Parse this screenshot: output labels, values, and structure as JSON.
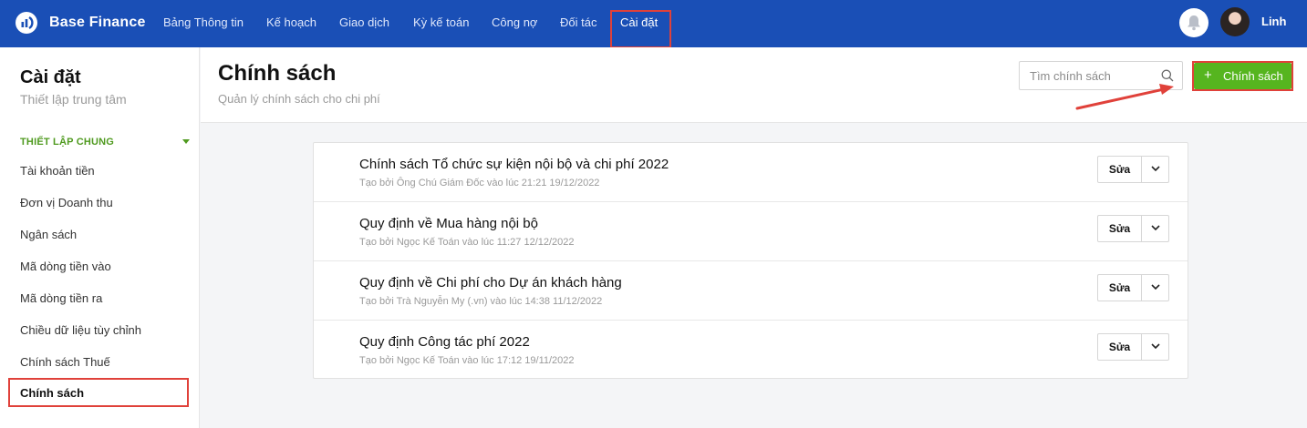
{
  "app": {
    "brand": "Base Finance",
    "user_name": "Linh"
  },
  "nav": {
    "items": [
      {
        "label": "Bảng Thông tin"
      },
      {
        "label": "Kế hoạch"
      },
      {
        "label": "Giao dịch"
      },
      {
        "label": "Kỳ kế toán"
      },
      {
        "label": "Công nợ"
      },
      {
        "label": "Đối tác"
      },
      {
        "label": "Cài đặt",
        "active": true
      }
    ]
  },
  "sidebar": {
    "title": "Cài đặt",
    "subtitle": "Thiết lập trung tâm",
    "section": "THIẾT LẬP CHUNG",
    "items": [
      {
        "label": "Tài khoản tiền"
      },
      {
        "label": "Đơn vị Doanh thu"
      },
      {
        "label": "Ngân sách"
      },
      {
        "label": "Mã dòng tiền vào"
      },
      {
        "label": "Mã dòng tiền ra"
      },
      {
        "label": "Chiều dữ liệu tùy chỉnh"
      },
      {
        "label": "Chính sách Thuế"
      },
      {
        "label": "Chính sách",
        "active": true
      }
    ]
  },
  "header": {
    "title": "Chính sách",
    "subtitle": "Quản lý chính sách cho chi phí",
    "search_placeholder": "Tìm chính sách",
    "add_button_label": "Chính sách",
    "add_button_icon": "plus-icon"
  },
  "policies": [
    {
      "title": "Chính sách Tổ chức sự kiện nội bộ và chi phí 2022",
      "meta": "Tạo bởi Ông Chú Giám Đốc vào lúc 21:21 19/12/2022"
    },
    {
      "title": "Quy định về Mua hàng nội bộ",
      "meta": "Tạo bởi Ngọc Kế Toán vào lúc 11:27 12/12/2022"
    },
    {
      "title": "Quy định về Chi phí cho Dự án khách hàng",
      "meta": "Tạo bởi Trà Nguyễn My (.vn) vào lúc 14:38 11/12/2022"
    },
    {
      "title": "Quy định Công tác phí 2022",
      "meta": "Tạo bởi Ngọc Kế Toán vào lúc 17:12 19/11/2022"
    }
  ],
  "row_actions": {
    "edit_label": "Sửa",
    "more_icon": "chevron-down-icon"
  },
  "colors": {
    "nav_bg": "#1a4fb6",
    "accent_green": "#56b51f",
    "section_green": "#4f9a1f",
    "annotation_red": "#e0413a"
  }
}
